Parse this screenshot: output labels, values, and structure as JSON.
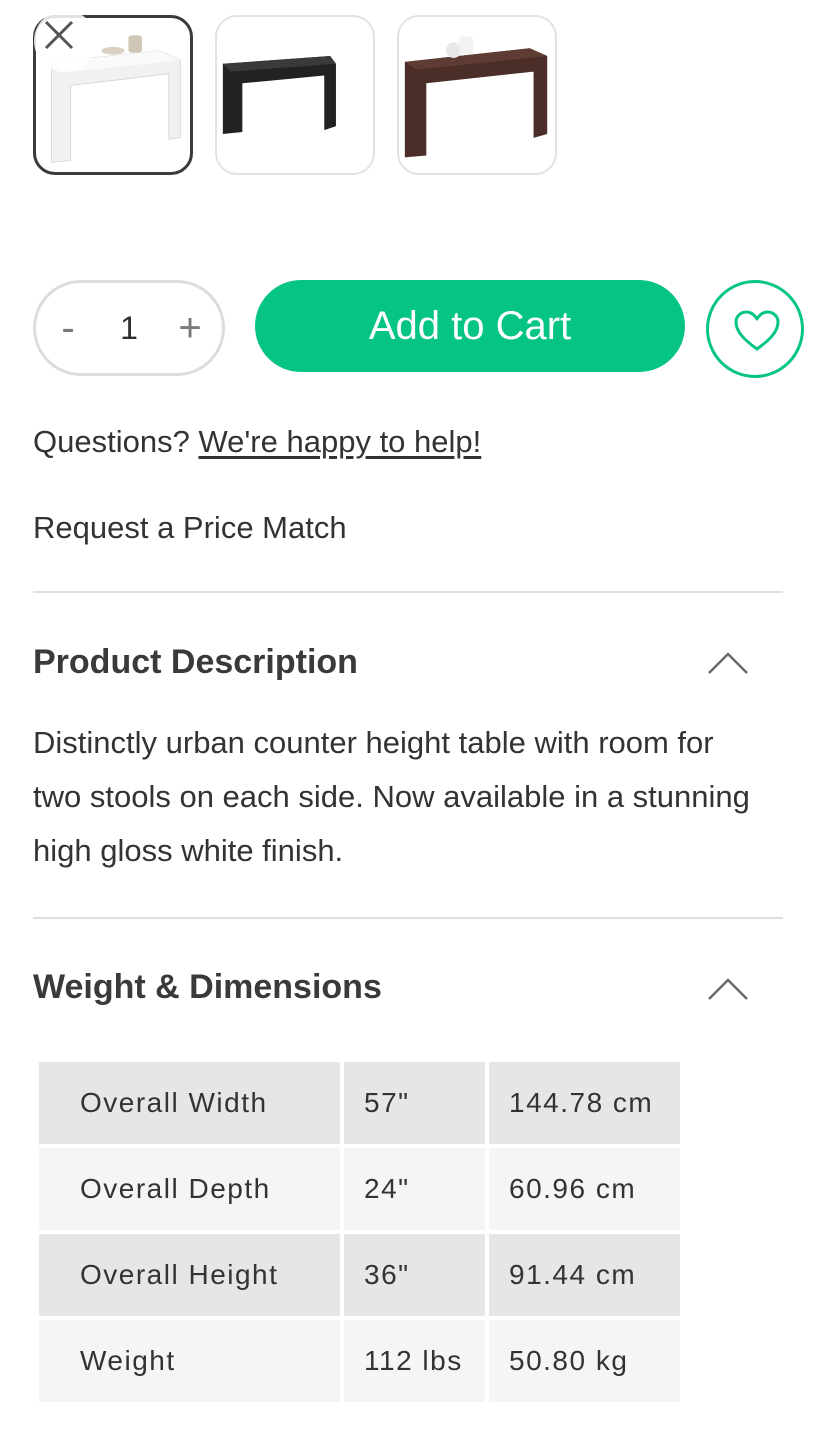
{
  "gallery": {
    "close_icon": "close-icon",
    "thumbnails": [
      {
        "finish": "white",
        "selected": true,
        "color": "#eeeeee"
      },
      {
        "finish": "black",
        "selected": false,
        "color": "#1e1e1e"
      },
      {
        "finish": "brown",
        "selected": false,
        "color": "#4a2e27"
      }
    ]
  },
  "purchase": {
    "decrement_label": "-",
    "quantity": "1",
    "increment_label": "+",
    "add_to_cart_label": "Add to Cart",
    "wishlist_icon": "heart-icon",
    "accent_color": "#05c485"
  },
  "help": {
    "questions_prefix": "Questions?",
    "help_link": "We're happy to help!",
    "price_match": "Request a Price Match"
  },
  "description": {
    "title": "Product Description",
    "toggle_icon": "chevron-up-icon",
    "text": "Distinctly urban counter height table with room for two stools on each side. Now available in a stunning high gloss white finish."
  },
  "dimensions": {
    "title": "Weight & Dimensions",
    "toggle_icon": "chevron-up-icon",
    "rows": [
      {
        "label": "Overall Width",
        "imperial": "57\"",
        "metric": "144.78 cm"
      },
      {
        "label": "Overall Depth",
        "imperial": "24\"",
        "metric": "60.96 cm"
      },
      {
        "label": "Overall Height",
        "imperial": "36\"",
        "metric": "91.44 cm"
      },
      {
        "label": "Weight",
        "imperial": "112 lbs",
        "metric": "50.80 kg"
      }
    ]
  }
}
